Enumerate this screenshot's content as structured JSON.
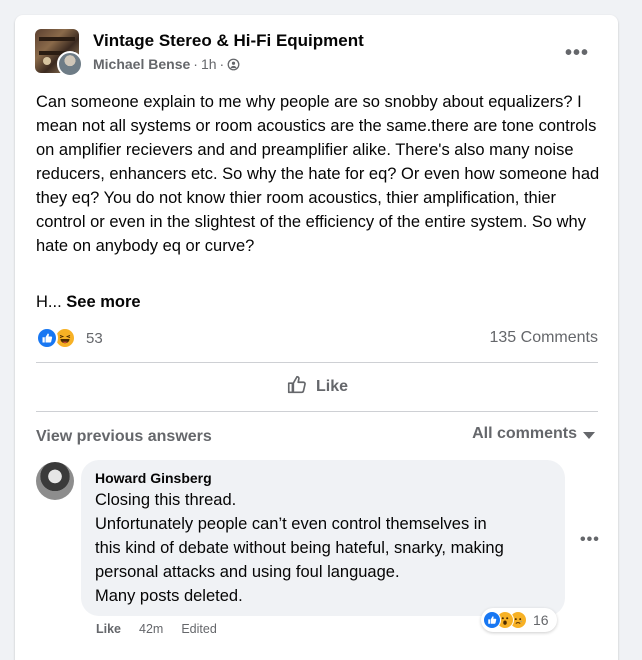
{
  "post": {
    "group_name": "Vintage Stereo & Hi-Fi Equipment",
    "author": "Michael Bense",
    "time": "1h",
    "separator": "·",
    "text": "Can someone explain to me why people are so snobby about equalizers? I mean not all systems or room acoustics are the same.there are tone controls on amplifier recievers and and preamplifier alike. There's also many noise reducers, enhancers etc. So why the hate for eq? Or even how someone had they eq? You do not know thier room acoustics, thier amplification, thier control or even in the slightest of the efficiency of the entire system. So why hate on anybody eq or curve?",
    "truncated_text": "H...",
    "see_more": "See more",
    "reaction_count": "53",
    "comments_count": "135 Comments",
    "more_label": "•••"
  },
  "actions": {
    "like_label": "Like"
  },
  "comments_section": {
    "view_previous": "View previous answers",
    "sort_label": "All comments"
  },
  "comment": {
    "author": "Howard Ginsberg",
    "lines": [
      "Closing this thread.",
      "Unfortunately people can’t even control themselves in",
      "this kind of debate without being hateful, snarky, making",
      "personal attacks and using foul language.",
      "Many posts deleted."
    ],
    "reaction_count": "16",
    "like_label": "Like",
    "time": "42m",
    "edited_label": "Edited",
    "more_label": "•••"
  },
  "colors": {
    "facebook_blue": "#1877f2",
    "secondary_text": "#65676b",
    "bubble_bg": "#f0f2f5"
  }
}
